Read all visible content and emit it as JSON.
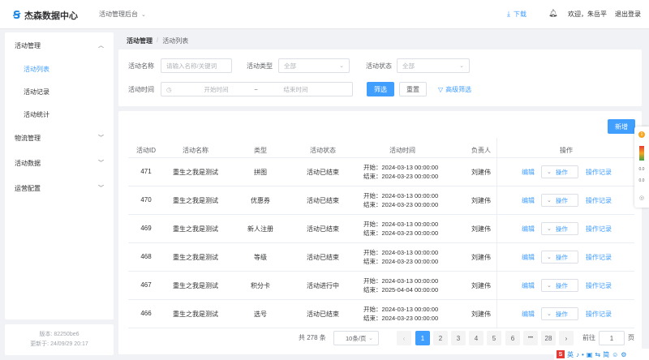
{
  "header": {
    "app_title": "杰森数据中心",
    "system_select": "活动管理后台",
    "download": "下载",
    "welcome": "欢迎，朱岳平",
    "logout": "退出登录"
  },
  "sidebar": {
    "groups": [
      {
        "label": "活动管理"
      },
      {
        "label": "物流管理"
      },
      {
        "label": "活动数据"
      },
      {
        "label": "运营配置"
      }
    ],
    "subitems": [
      {
        "label": "活动列表"
      },
      {
        "label": "活动记录"
      },
      {
        "label": "活动统计"
      }
    ],
    "version": "版本: 82250be6",
    "updated": "更新于: 24/09/29 20:17"
  },
  "breadcrumb": {
    "root": "活动管理",
    "sep": "/",
    "current": "活动列表"
  },
  "filters": {
    "name_label": "活动名称",
    "name_placeholder": "请输入名称/关键词",
    "type_label": "活动类型",
    "type_value": "全部",
    "status_label": "活动状态",
    "status_value": "全部",
    "time_label": "活动时间",
    "start_placeholder": "开始时间",
    "range_sep": "~",
    "end_placeholder": "结束时间",
    "search_btn": "筛选",
    "reset_btn": "重置",
    "advanced": "高级筛选"
  },
  "table": {
    "add_btn": "新增",
    "headers": [
      "活动ID",
      "活动名称",
      "类型",
      "活动状态",
      "活动时间",
      "负责人",
      "操作"
    ],
    "rows": [
      {
        "id": "471",
        "name": "重生之我是测试",
        "type": "拼图",
        "status": "活动已结束",
        "start": "开始：2024-03-13 00:00:00",
        "end": "结束：2024-03-23 00:00:00",
        "owner": "刘建伟"
      },
      {
        "id": "470",
        "name": "重生之我是测试",
        "type": "优惠券",
        "status": "活动已结束",
        "start": "开始：2024-03-13 00:00:00",
        "end": "结束：2024-03-23 00:00:00",
        "owner": "刘建伟"
      },
      {
        "id": "469",
        "name": "重生之我是测试",
        "type": "新人注册",
        "status": "活动已结束",
        "start": "开始：2024-03-13 00:00:00",
        "end": "结束：2024-03-23 00:00:00",
        "owner": "刘建伟"
      },
      {
        "id": "468",
        "name": "重生之我是测试",
        "type": "等级",
        "status": "活动已结束",
        "start": "开始：2024-03-13 00:00:00",
        "end": "结束：2024-03-23 00:00:00",
        "owner": "刘建伟"
      },
      {
        "id": "467",
        "name": "重生之我是测试",
        "type": "积分卡",
        "status": "活动进行中",
        "start": "开始：2024-03-13 00:00:00",
        "end": "结束：2025-04-04 00:00:00",
        "owner": "刘建伟"
      },
      {
        "id": "466",
        "name": "重生之我是测试",
        "type": "选号",
        "status": "活动已结束",
        "start": "开始：2024-03-13 00:00:00",
        "end": "结束：2024-03-23 00:00:00",
        "owner": "刘建伟"
      }
    ],
    "edit": "编辑",
    "operate": "操作",
    "record": "操作记录"
  },
  "pagination": {
    "total": "共 278 条",
    "page_size": "10条/页",
    "pages": [
      "1",
      "2",
      "3",
      "4",
      "5",
      "6",
      "28"
    ],
    "ellipsis": "•••",
    "goto": "前往",
    "goto_value": "1",
    "page_unit": "页"
  },
  "float_bar": {
    "items": [
      "1",
      "0.0",
      "0.0"
    ]
  },
  "ime": {
    "items": [
      "英",
      "♪",
      "•",
      "▣",
      "⇆",
      "简",
      "☺",
      "⚙"
    ]
  },
  "colors": {
    "primary": "#409eff",
    "text": "#303133",
    "muted": "#606266",
    "border": "#dcdfe6"
  }
}
